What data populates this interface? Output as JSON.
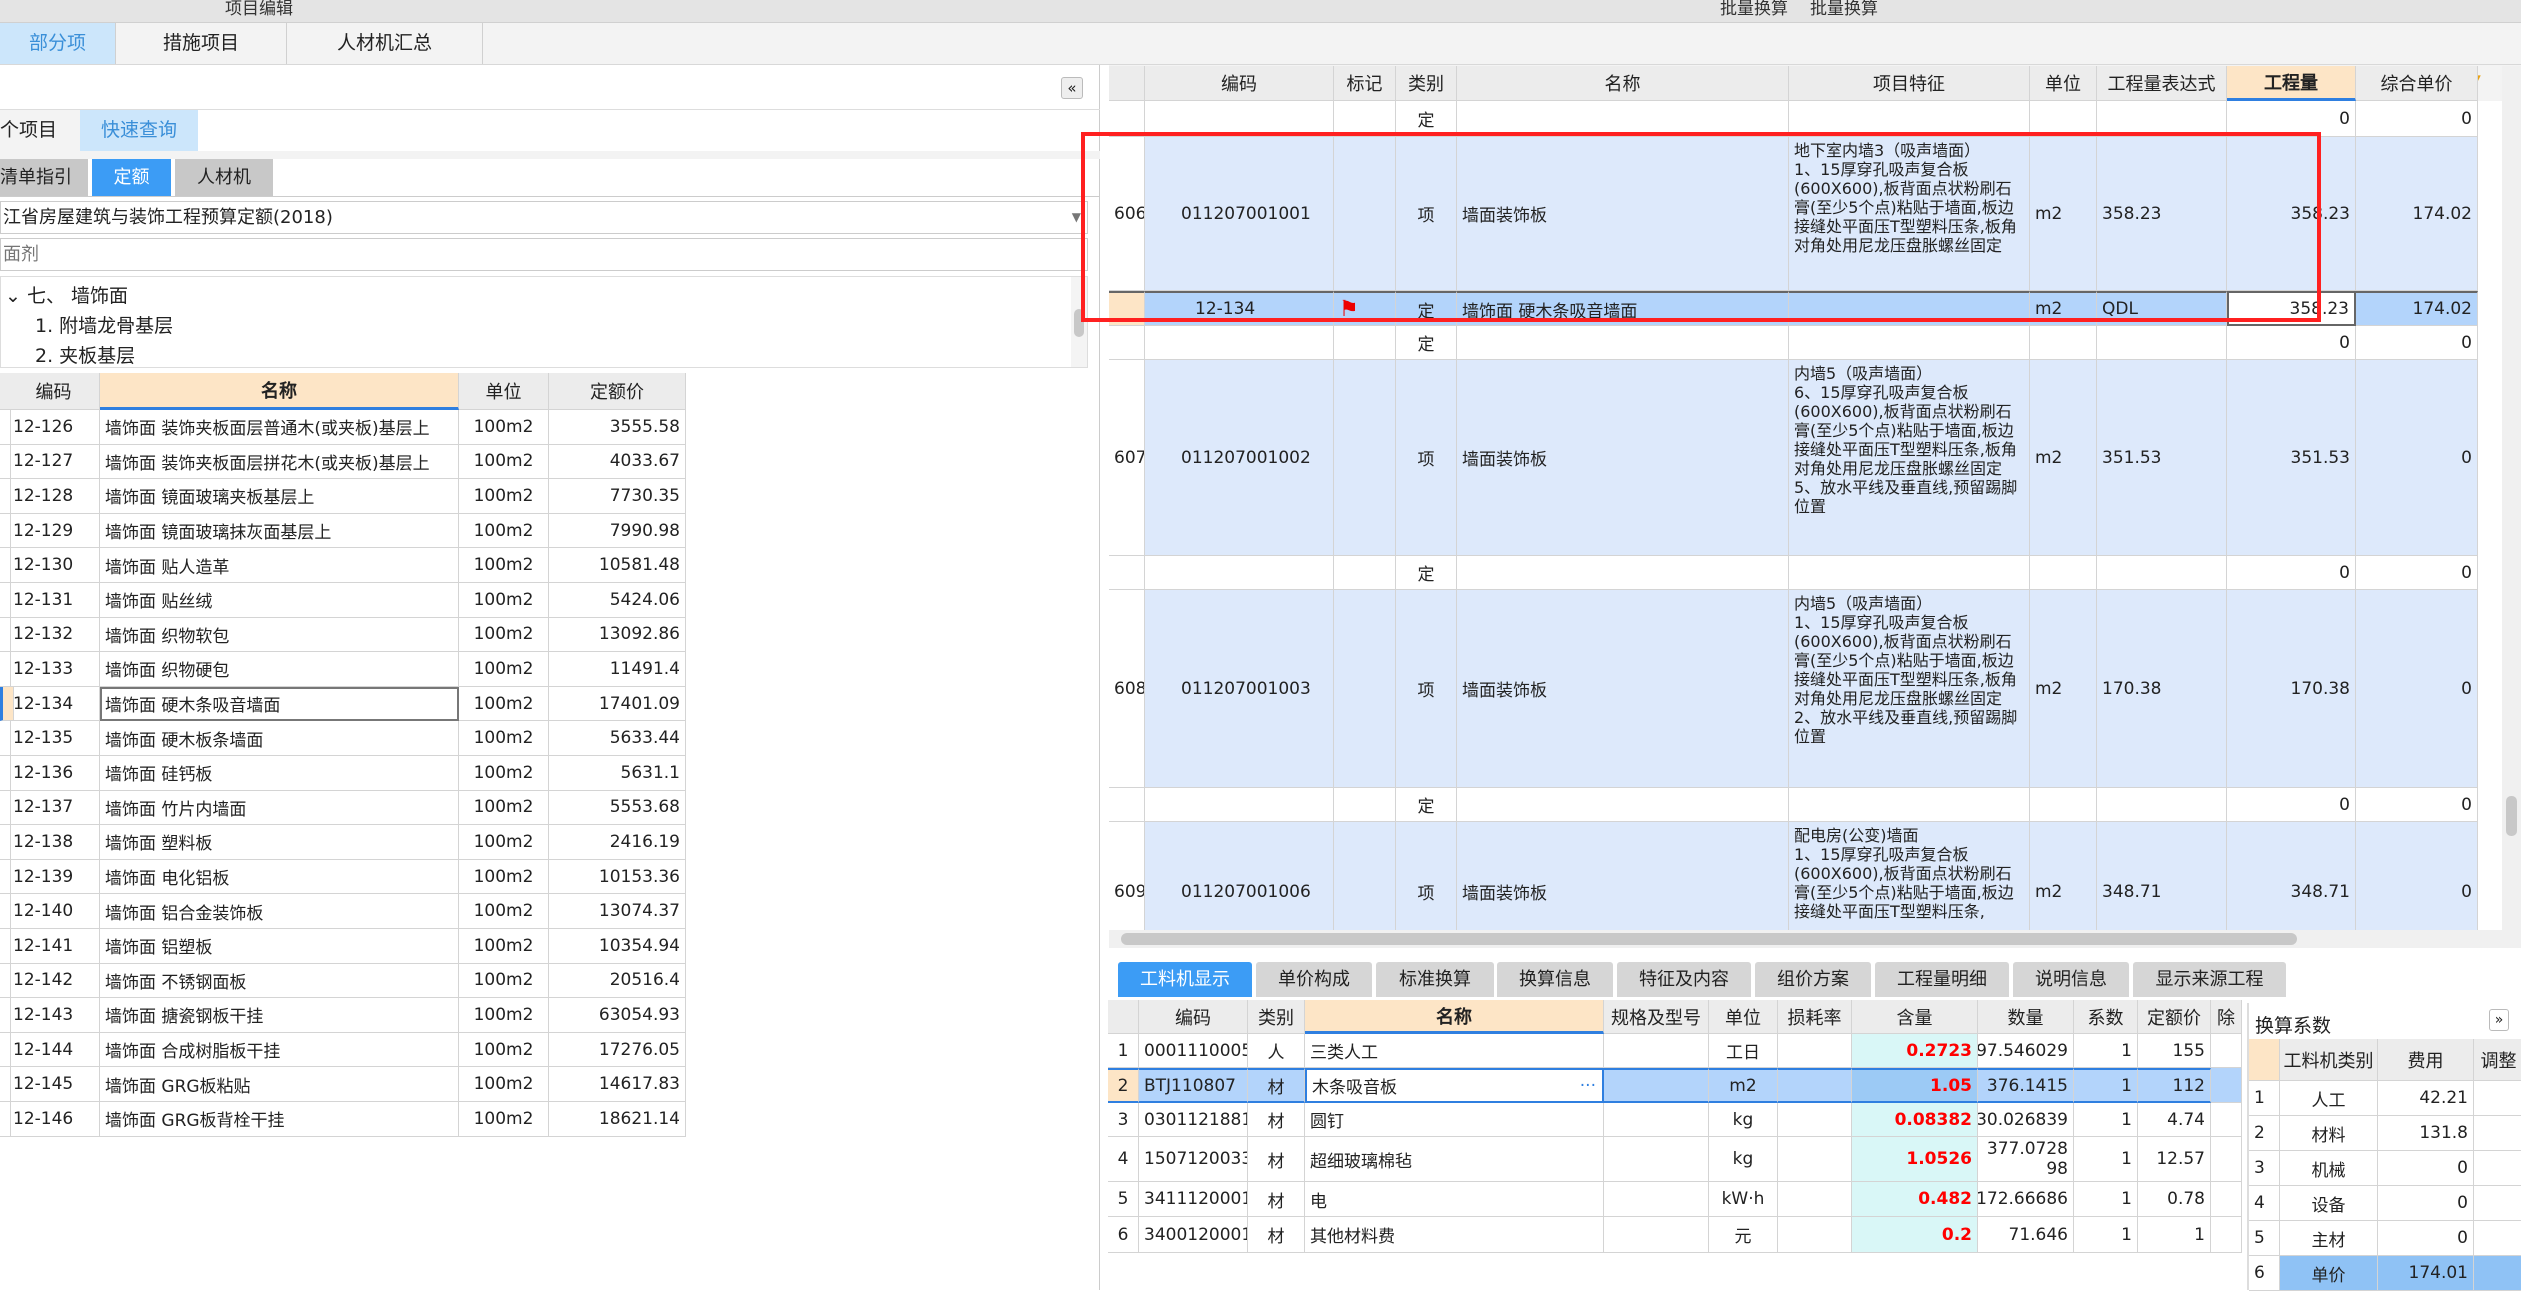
{
  "topbar": {
    "item1": "项目编辑",
    "item2": "批量换算",
    "item3": "批量换算"
  },
  "tabs": [
    {
      "label": "部分项",
      "active": true
    },
    {
      "label": "措施项目"
    },
    {
      "label": "人材机汇总"
    }
  ],
  "left": {
    "subtabs": [
      {
        "label": "个项目"
      },
      {
        "label": "快速查询",
        "active": true
      }
    ],
    "libtabs": [
      {
        "label": "清单指引"
      },
      {
        "label": "定额",
        "active": true
      },
      {
        "label": "人材机"
      }
    ],
    "library": "江省房屋建筑与装饰工程预算定额(2018)",
    "search_placeholder": "面剂",
    "tree": [
      {
        "label": "七、 墙饰面",
        "expanded": true
      },
      {
        "label": "1. 附墙龙骨基层"
      },
      {
        "label": "2. 夹板基层"
      }
    ],
    "columns": [
      "编码",
      "名称",
      "单位",
      "定额价"
    ],
    "rows": [
      [
        "12-126",
        "墙饰面 装饰夹板面层普通木(或夹板)基层上",
        "100m2",
        "3555.58"
      ],
      [
        "12-127",
        "墙饰面 装饰夹板面层拼花木(或夹板)基层上",
        "100m2",
        "4033.67"
      ],
      [
        "12-128",
        "墙饰面 镜面玻璃夹板基层上",
        "100m2",
        "7730.35"
      ],
      [
        "12-129",
        "墙饰面 镜面玻璃抹灰面基层上",
        "100m2",
        "7990.98"
      ],
      [
        "12-130",
        "墙饰面 贴人造革",
        "100m2",
        "10581.48"
      ],
      [
        "12-131",
        "墙饰面 贴丝绒",
        "100m2",
        "5424.06"
      ],
      [
        "12-132",
        "墙饰面 织物软包",
        "100m2",
        "13092.86"
      ],
      [
        "12-133",
        "墙饰面 织物硬包",
        "100m2",
        "11491.4"
      ],
      [
        "12-134",
        "墙饰面 硬木条吸音墙面",
        "100m2",
        "17401.09"
      ],
      [
        "12-135",
        "墙饰面 硬木板条墙面",
        "100m2",
        "5633.44"
      ],
      [
        "12-136",
        "墙饰面 硅钙板",
        "100m2",
        "5631.1"
      ],
      [
        "12-137",
        "墙饰面 竹片内墙面",
        "100m2",
        "5553.68"
      ],
      [
        "12-138",
        "墙饰面 塑料板",
        "100m2",
        "2416.19"
      ],
      [
        "12-139",
        "墙饰面 电化铝板",
        "100m2",
        "10153.36"
      ],
      [
        "12-140",
        "墙饰面 铝合金装饰板",
        "100m2",
        "13074.37"
      ],
      [
        "12-141",
        "墙饰面 铝塑板",
        "100m2",
        "10354.94"
      ],
      [
        "12-142",
        "墙饰面 不锈钢面板",
        "100m2",
        "20516.4"
      ],
      [
        "12-143",
        "墙饰面 搪瓷钢板干挂",
        "100m2",
        "63054.93"
      ],
      [
        "12-144",
        "墙饰面 合成树脂板干挂",
        "100m2",
        "17276.05"
      ],
      [
        "12-145",
        "墙饰面 GRG板粘贴",
        "100m2",
        "14617.83"
      ],
      [
        "12-146",
        "墙饰面 GRG板背栓干挂",
        "100m2",
        "18621.14"
      ]
    ],
    "selected_row": 8
  },
  "main": {
    "columns": [
      "",
      "编码",
      "标记",
      "类别",
      "名称",
      "项目特征",
      "单位",
      "工程量表达式",
      "工程量",
      "综合单价"
    ],
    "rows": [
      {
        "no": "",
        "code": "",
        "mark": "",
        "type": "定",
        "name": "",
        "feature": "",
        "unit": "",
        "expr": "",
        "qty": "0",
        "price": "0",
        "kind": "sub"
      },
      {
        "no": "606",
        "code": "011207001001",
        "mark": "",
        "type": "项",
        "name": "墙面装饰板",
        "feature": "地下室内墙3（吸声墙面）\n1、15厚穿孔吸声复合板(600X600),板背面点状粉刷石膏(至少5个点)粘贴于墙面,板边接缝处平面压T型塑料压条,板角对角处用尼龙压盘胀螺丝固定",
        "unit": "m2",
        "expr": "358.23",
        "qty": "358.23",
        "price": "174.02",
        "kind": "item"
      },
      {
        "no": "",
        "code": "12-134",
        "mark": "flag",
        "type": "定",
        "name": "墙饰面 硬木条吸音墙面",
        "feature": "",
        "unit": "m2",
        "expr": "QDL",
        "qty": "358.23",
        "price": "174.02",
        "kind": "selected"
      },
      {
        "no": "",
        "code": "",
        "mark": "",
        "type": "定",
        "name": "",
        "feature": "",
        "unit": "",
        "expr": "",
        "qty": "0",
        "price": "0",
        "kind": "sub"
      },
      {
        "no": "607",
        "code": "011207001002",
        "mark": "",
        "type": "项",
        "name": "墙面装饰板",
        "feature": "内墙5（吸声墙面）\n6、15厚穿孔吸声复合板(600X600),板背面点状粉刷石膏(至少5个点)粘贴于墙面,板边接缝处平面压T型塑料压条,板角对角处用尼龙压盘胀螺丝固定\n5、放水平线及垂直线,预留踢脚位置",
        "unit": "m2",
        "expr": "351.53",
        "qty": "351.53",
        "price": "0",
        "kind": "item"
      },
      {
        "no": "",
        "code": "",
        "mark": "",
        "type": "定",
        "name": "",
        "feature": "",
        "unit": "",
        "expr": "",
        "qty": "0",
        "price": "0",
        "kind": "sub"
      },
      {
        "no": "608",
        "code": "011207001003",
        "mark": "",
        "type": "项",
        "name": "墙面装饰板",
        "feature": "内墙5（吸声墙面）\n1、15厚穿孔吸声复合板(600X600),板背面点状粉刷石膏(至少5个点)粘贴于墙面,板边接缝处平面压T型塑料压条,板角对角处用尼龙压盘胀螺丝固定\n2、放水平线及垂直线,预留踢脚位置",
        "unit": "m2",
        "expr": "170.38",
        "qty": "170.38",
        "price": "0",
        "kind": "item"
      },
      {
        "no": "",
        "code": "",
        "mark": "",
        "type": "定",
        "name": "",
        "feature": "",
        "unit": "",
        "expr": "",
        "qty": "0",
        "price": "0",
        "kind": "sub"
      },
      {
        "no": "609",
        "code": "011207001006",
        "mark": "",
        "type": "项",
        "name": "墙面装饰板",
        "feature": "配电房(公变)墙面\n1、15厚穿孔吸声复合板(600X600),板背面点状粉刷石膏(至少5个点)粘贴于墙面,板边接缝处平面压T型塑料压条,",
        "unit": "m2",
        "expr": "348.71",
        "qty": "348.71",
        "price": "0",
        "kind": "item"
      }
    ]
  },
  "bottom": {
    "tabs": [
      "工料机显示",
      "单价构成",
      "标准换算",
      "换算信息",
      "特征及内容",
      "组价方案",
      "工程量明细",
      "说明信息",
      "显示来源工程"
    ],
    "columns": [
      "",
      "编码",
      "类别",
      "名称",
      "规格及型号",
      "单位",
      "损耗率",
      "含量",
      "数量",
      "系数",
      "定额价",
      "除"
    ],
    "rows": [
      [
        "1",
        "0001110005",
        "人",
        "三类人工",
        "",
        "工日",
        "",
        "0.2723",
        "97.546029",
        "1",
        "155"
      ],
      [
        "2",
        "BTJ110807",
        "材",
        "木条吸音板",
        "",
        "m2",
        "",
        "1.05",
        "376.1415",
        "1",
        "112"
      ],
      [
        "3",
        "0301121881",
        "材",
        "圆钉",
        "",
        "kg",
        "",
        "0.08382",
        "30.026839",
        "1",
        "4.74"
      ],
      [
        "4",
        "1507120033",
        "材",
        "超细玻璃棉毡",
        "",
        "kg",
        "",
        "1.0526",
        "377.072898",
        "1",
        "12.57"
      ],
      [
        "5",
        "3411120001",
        "材",
        "电",
        "",
        "kW·h",
        "",
        "0.482",
        "172.66686",
        "1",
        "0.78"
      ],
      [
        "6",
        "3400120001",
        "材",
        "其他材料费",
        "",
        "元",
        "",
        "0.2",
        "71.646",
        "1",
        "1"
      ]
    ],
    "selected_row": 1
  },
  "coef": {
    "title": "换算系数",
    "columns": [
      "",
      "工料机类别",
      "费用",
      "调整"
    ],
    "rows": [
      [
        "1",
        "人工",
        "42.21"
      ],
      [
        "2",
        "材料",
        "131.8"
      ],
      [
        "3",
        "机械",
        "0"
      ],
      [
        "4",
        "设备",
        "0"
      ],
      [
        "5",
        "主材",
        "0"
      ],
      [
        "6",
        "单价",
        "174.01"
      ]
    ]
  },
  "colors": {
    "accent": "#3c9cf5",
    "selected_row": "#b3d4fb",
    "item_row": "#dde9fb",
    "highlight_box": "#ff2020",
    "qty_bg": "#d9f7f7"
  }
}
